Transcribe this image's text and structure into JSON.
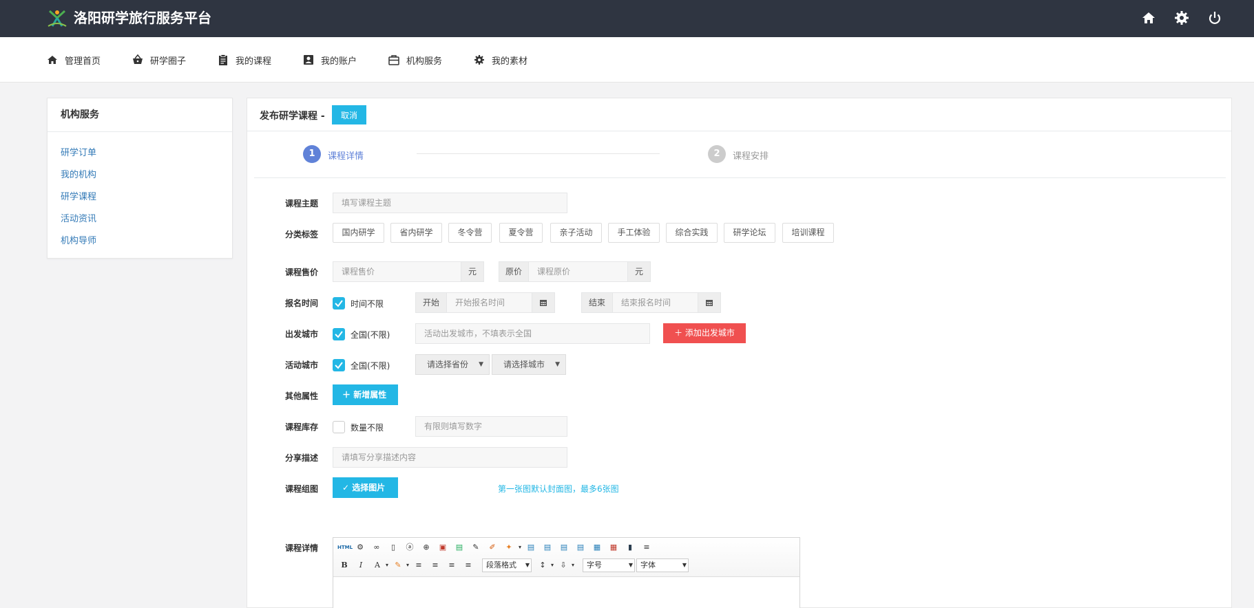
{
  "brand": {
    "title": "洛阳研学旅行服务平台"
  },
  "top_icons": [
    "home-icon",
    "gear-icon",
    "power-icon"
  ],
  "nav": {
    "items": [
      {
        "label": "管理首页",
        "icon": "home-icon"
      },
      {
        "label": "研学圈子",
        "icon": "basket-icon"
      },
      {
        "label": "我的课程",
        "icon": "clipboard-icon"
      },
      {
        "label": "我的账户",
        "icon": "account-icon"
      },
      {
        "label": "机构服务",
        "icon": "briefcase-icon"
      },
      {
        "label": "我的素材",
        "icon": "gear-icon"
      }
    ]
  },
  "sidebar": {
    "title": "机构服务",
    "items": [
      "研学订单",
      "我的机构",
      "研学课程",
      "活动资讯",
      "机构导师"
    ]
  },
  "panel": {
    "title": "发布研学课程",
    "separator": "-",
    "cancel": "取消"
  },
  "steps": [
    {
      "num": "1",
      "label": "课程详情",
      "active": true
    },
    {
      "num": "2",
      "label": "课程安排",
      "active": false
    }
  ],
  "form": {
    "theme": {
      "label": "课程主题",
      "placeholder": "填写课程主题"
    },
    "tags": {
      "label": "分类标签",
      "items": [
        "国内研学",
        "省内研学",
        "冬令营",
        "夏令营",
        "亲子活动",
        "手工体验",
        "综合实践",
        "研学论坛",
        "培训课程"
      ]
    },
    "price": {
      "label": "课程售价",
      "placeholder": "课程售价",
      "unit": "元",
      "orig_label": "原价",
      "orig_placeholder": "课程原价",
      "orig_unit": "元"
    },
    "signup": {
      "label": "报名时间",
      "check": "时间不限",
      "start_label": "开始",
      "start_placeholder": "开始报名时间",
      "end_label": "结束",
      "end_placeholder": "结束报名时间"
    },
    "depart": {
      "label": "出发城市",
      "check": "全国(不限)",
      "placeholder": "活动出发城市，不填表示全国",
      "add_button": "添加出发城市"
    },
    "activity_city": {
      "label": "活动城市",
      "check": "全国(不限)",
      "province": "请选择省份",
      "city": "请选择城市"
    },
    "other": {
      "label": "其他属性",
      "button": "新增属性"
    },
    "stock": {
      "label": "课程库存",
      "check": "数量不限",
      "placeholder": "有限则填写数字"
    },
    "share": {
      "label": "分享描述",
      "placeholder": "请填写分享描述内容"
    },
    "images": {
      "label": "课程组图",
      "button": "选择图片",
      "hint": "第一张图默认封面图，最多6张图"
    },
    "detail": {
      "label": "课程详情"
    }
  },
  "editor": {
    "html_label": "HTML",
    "bold": "B",
    "italic": "I",
    "font_color": "A",
    "paragraph": "段落格式",
    "font_size": "字号",
    "font_family": "字体"
  },
  "colors": {
    "topbar": "#2f3541",
    "accent": "#23b7e5",
    "danger": "#f05050",
    "step_active": "#6082d8",
    "step_inactive": "#cccccc"
  }
}
